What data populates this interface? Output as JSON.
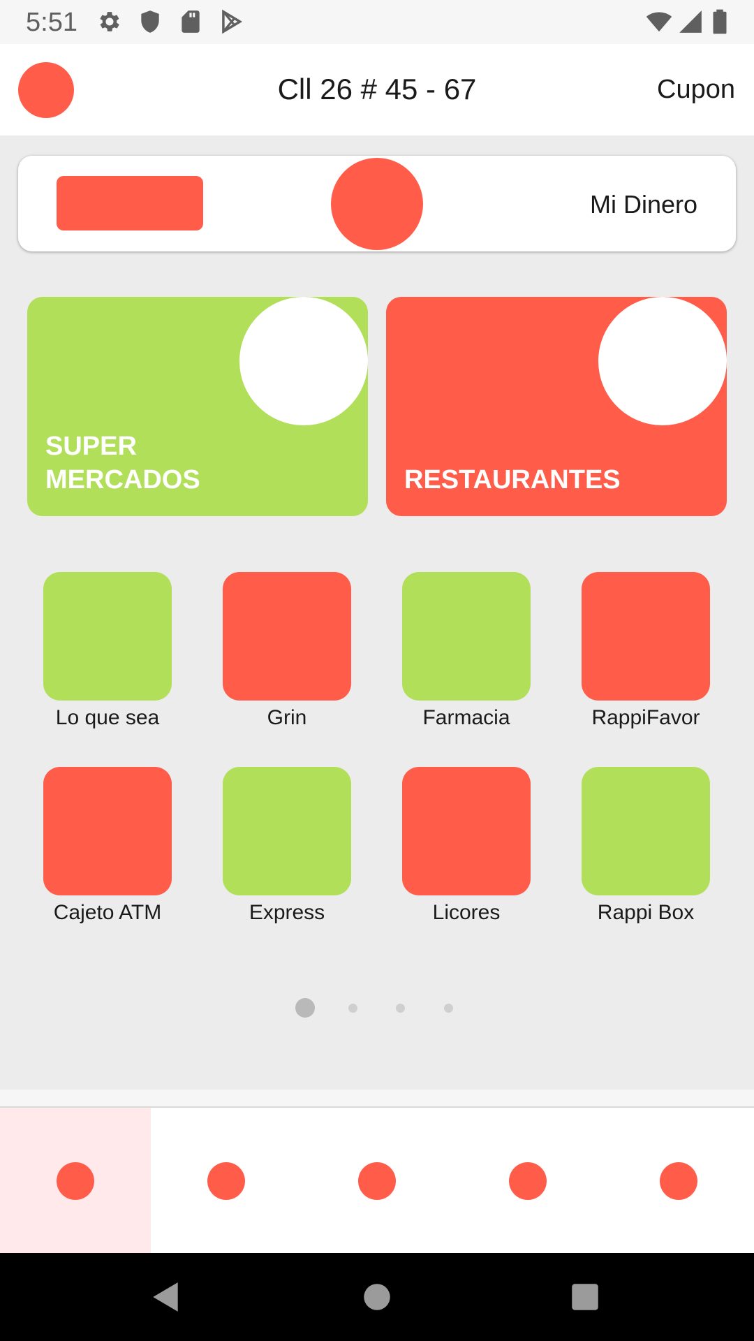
{
  "status_bar": {
    "time": "5:51",
    "left_icons": [
      "gear-icon",
      "shield-icon",
      "sd-card-icon",
      "play-store-icon"
    ],
    "right_icons": [
      "wifi-icon",
      "signal-icon",
      "battery-icon"
    ]
  },
  "app_bar": {
    "address": "Cll 26 # 45 - 67",
    "coupon_label": "Cupon"
  },
  "wallet": {
    "label": "Mi Dinero"
  },
  "categories": [
    {
      "title": "SUPER\nMERCADOS",
      "color": "#b1df5a"
    },
    {
      "title": "RESTAURANTES",
      "color": "#ff5c4a"
    }
  ],
  "shortcuts": [
    {
      "label": "Lo que sea",
      "color": "#b1df5a"
    },
    {
      "label": "Grin",
      "color": "#ff5c4a"
    },
    {
      "label": "Farmacia",
      "color": "#b1df5a"
    },
    {
      "label": "RappiFavor",
      "color": "#ff5c4a"
    },
    {
      "label": "Cajeto ATM",
      "color": "#ff5c4a"
    },
    {
      "label": "Express",
      "color": "#b1df5a"
    },
    {
      "label": "Licores",
      "color": "#ff5c4a"
    },
    {
      "label": "Rappi Box",
      "color": "#b1df5a"
    }
  ],
  "pager": {
    "page_count": 4,
    "active_index": 0
  },
  "bottom_nav": {
    "item_count": 5,
    "active_index": 0
  },
  "colors": {
    "accent_red": "#ff5c4a",
    "accent_green": "#b1df5a",
    "active_nav_bg": "#ffe9eb"
  },
  "system_nav": [
    "back-icon",
    "home-icon",
    "recents-icon"
  ]
}
